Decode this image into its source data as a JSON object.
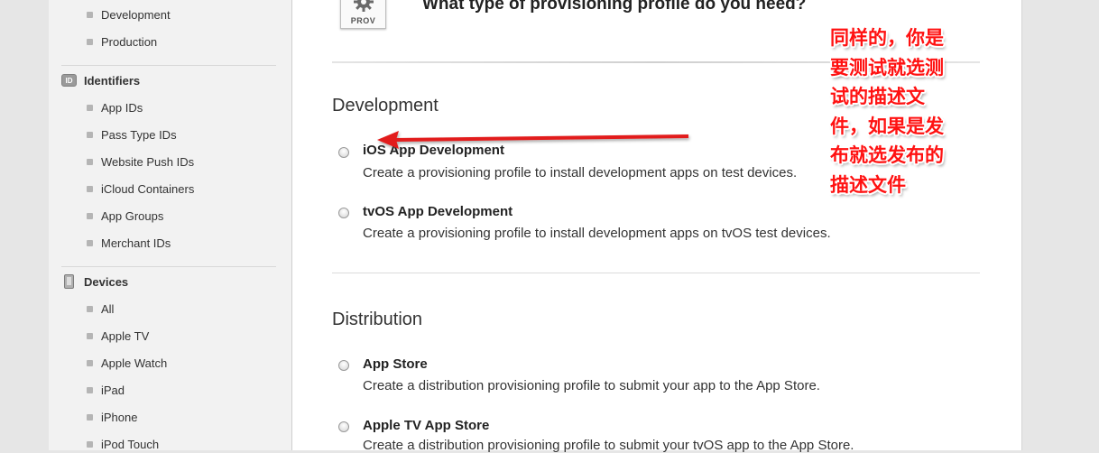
{
  "sidebar": {
    "certificates_items": [
      "Development",
      "Production"
    ],
    "identifiers": {
      "icon_text": "ID",
      "title": "Identifiers",
      "items": [
        "App IDs",
        "Pass Type IDs",
        "Website Push IDs",
        "iCloud Containers",
        "App Groups",
        "Merchant IDs"
      ]
    },
    "devices": {
      "title": "Devices",
      "items": [
        "All",
        "Apple TV",
        "Apple Watch",
        "iPad",
        "iPhone",
        "iPod Touch"
      ]
    }
  },
  "main": {
    "icon_label": "PROV",
    "question": "What type of provisioning profile do you need?",
    "development": {
      "title": "Development",
      "options": [
        {
          "title": "iOS App Development",
          "desc": "Create a provisioning profile to install development apps on test devices."
        },
        {
          "title": "tvOS App Development",
          "desc": "Create a provisioning profile to install development apps on tvOS test devices."
        }
      ]
    },
    "distribution": {
      "title": "Distribution",
      "options": [
        {
          "title": "App Store",
          "desc": "Create a distribution provisioning profile to submit your app to the App Store."
        },
        {
          "title": "Apple TV App Store",
          "desc": "Create a distribution provisioning profile to submit your tvOS app to the App Store."
        }
      ]
    }
  },
  "annotation": {
    "lines": [
      "同样的，你是",
      "要测试就选测",
      "试的描述文",
      "件，如果是发",
      "布就选发布的",
      "描述文件"
    ],
    "color": "#ff1111"
  }
}
